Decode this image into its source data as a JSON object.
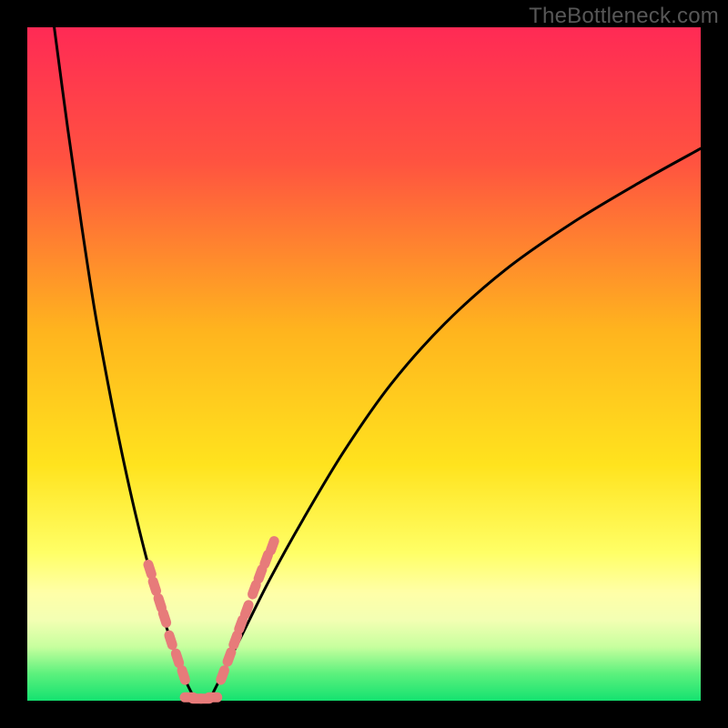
{
  "watermark": "TheBottleneck.com",
  "colors": {
    "frame": "#000000",
    "curve": "#000000",
    "marker_fill": "#e77b7a",
    "marker_stroke": "#e77b7a"
  },
  "gradient_stops": [
    {
      "offset": 0,
      "color": "#ff2a55"
    },
    {
      "offset": 20,
      "color": "#ff5340"
    },
    {
      "offset": 45,
      "color": "#ffb41e"
    },
    {
      "offset": 65,
      "color": "#ffe31e"
    },
    {
      "offset": 78,
      "color": "#ffff66"
    },
    {
      "offset": 84,
      "color": "#ffffa8"
    },
    {
      "offset": 88,
      "color": "#f3ffb3"
    },
    {
      "offset": 92,
      "color": "#c7ff9e"
    },
    {
      "offset": 96,
      "color": "#5cf17d"
    },
    {
      "offset": 100,
      "color": "#14e270"
    }
  ],
  "chart_data": {
    "type": "line",
    "title": "",
    "xlabel": "",
    "ylabel": "",
    "xlim": [
      0,
      100
    ],
    "ylim": [
      0,
      100
    ],
    "grid": false,
    "series": [
      {
        "name": "left-branch",
        "x": [
          4,
          6,
          8,
          10,
          12,
          14,
          16,
          18,
          20,
          22,
          23.5,
          25
        ],
        "y": [
          100,
          85,
          71,
          58,
          47,
          37,
          28,
          20,
          13,
          7,
          3,
          0
        ]
      },
      {
        "name": "right-branch",
        "x": [
          27,
          29,
          32,
          36,
          41,
          47,
          54,
          62,
          71,
          81,
          91,
          100
        ],
        "y": [
          0,
          4,
          10,
          18,
          27,
          37,
          47,
          56,
          64,
          71,
          77,
          82
        ]
      }
    ],
    "markers": [
      {
        "series": "left-branch",
        "x": 18.2,
        "y": 19.5
      },
      {
        "series": "left-branch",
        "x": 18.9,
        "y": 17.0
      },
      {
        "series": "left-branch",
        "x": 19.7,
        "y": 14.5
      },
      {
        "series": "left-branch",
        "x": 20.4,
        "y": 12.3
      },
      {
        "series": "left-branch",
        "x": 21.3,
        "y": 9.0
      },
      {
        "series": "left-branch",
        "x": 22.3,
        "y": 6.3
      },
      {
        "series": "left-branch",
        "x": 23.2,
        "y": 3.8
      },
      {
        "series": "floor",
        "x": 24.0,
        "y": 0.5
      },
      {
        "series": "floor",
        "x": 25.2,
        "y": 0.3
      },
      {
        "series": "floor",
        "x": 26.4,
        "y": 0.3
      },
      {
        "series": "floor",
        "x": 27.6,
        "y": 0.5
      },
      {
        "series": "right-branch",
        "x": 29.0,
        "y": 3.8
      },
      {
        "series": "right-branch",
        "x": 30.0,
        "y": 6.5
      },
      {
        "series": "right-branch",
        "x": 30.9,
        "y": 9.0
      },
      {
        "series": "right-branch",
        "x": 31.7,
        "y": 11.3
      },
      {
        "series": "right-branch",
        "x": 32.6,
        "y": 13.5
      },
      {
        "series": "right-branch",
        "x": 33.7,
        "y": 16.5
      },
      {
        "series": "right-branch",
        "x": 34.6,
        "y": 18.8
      },
      {
        "series": "right-branch",
        "x": 35.5,
        "y": 21.0
      },
      {
        "series": "right-branch",
        "x": 36.4,
        "y": 23.0
      }
    ]
  }
}
